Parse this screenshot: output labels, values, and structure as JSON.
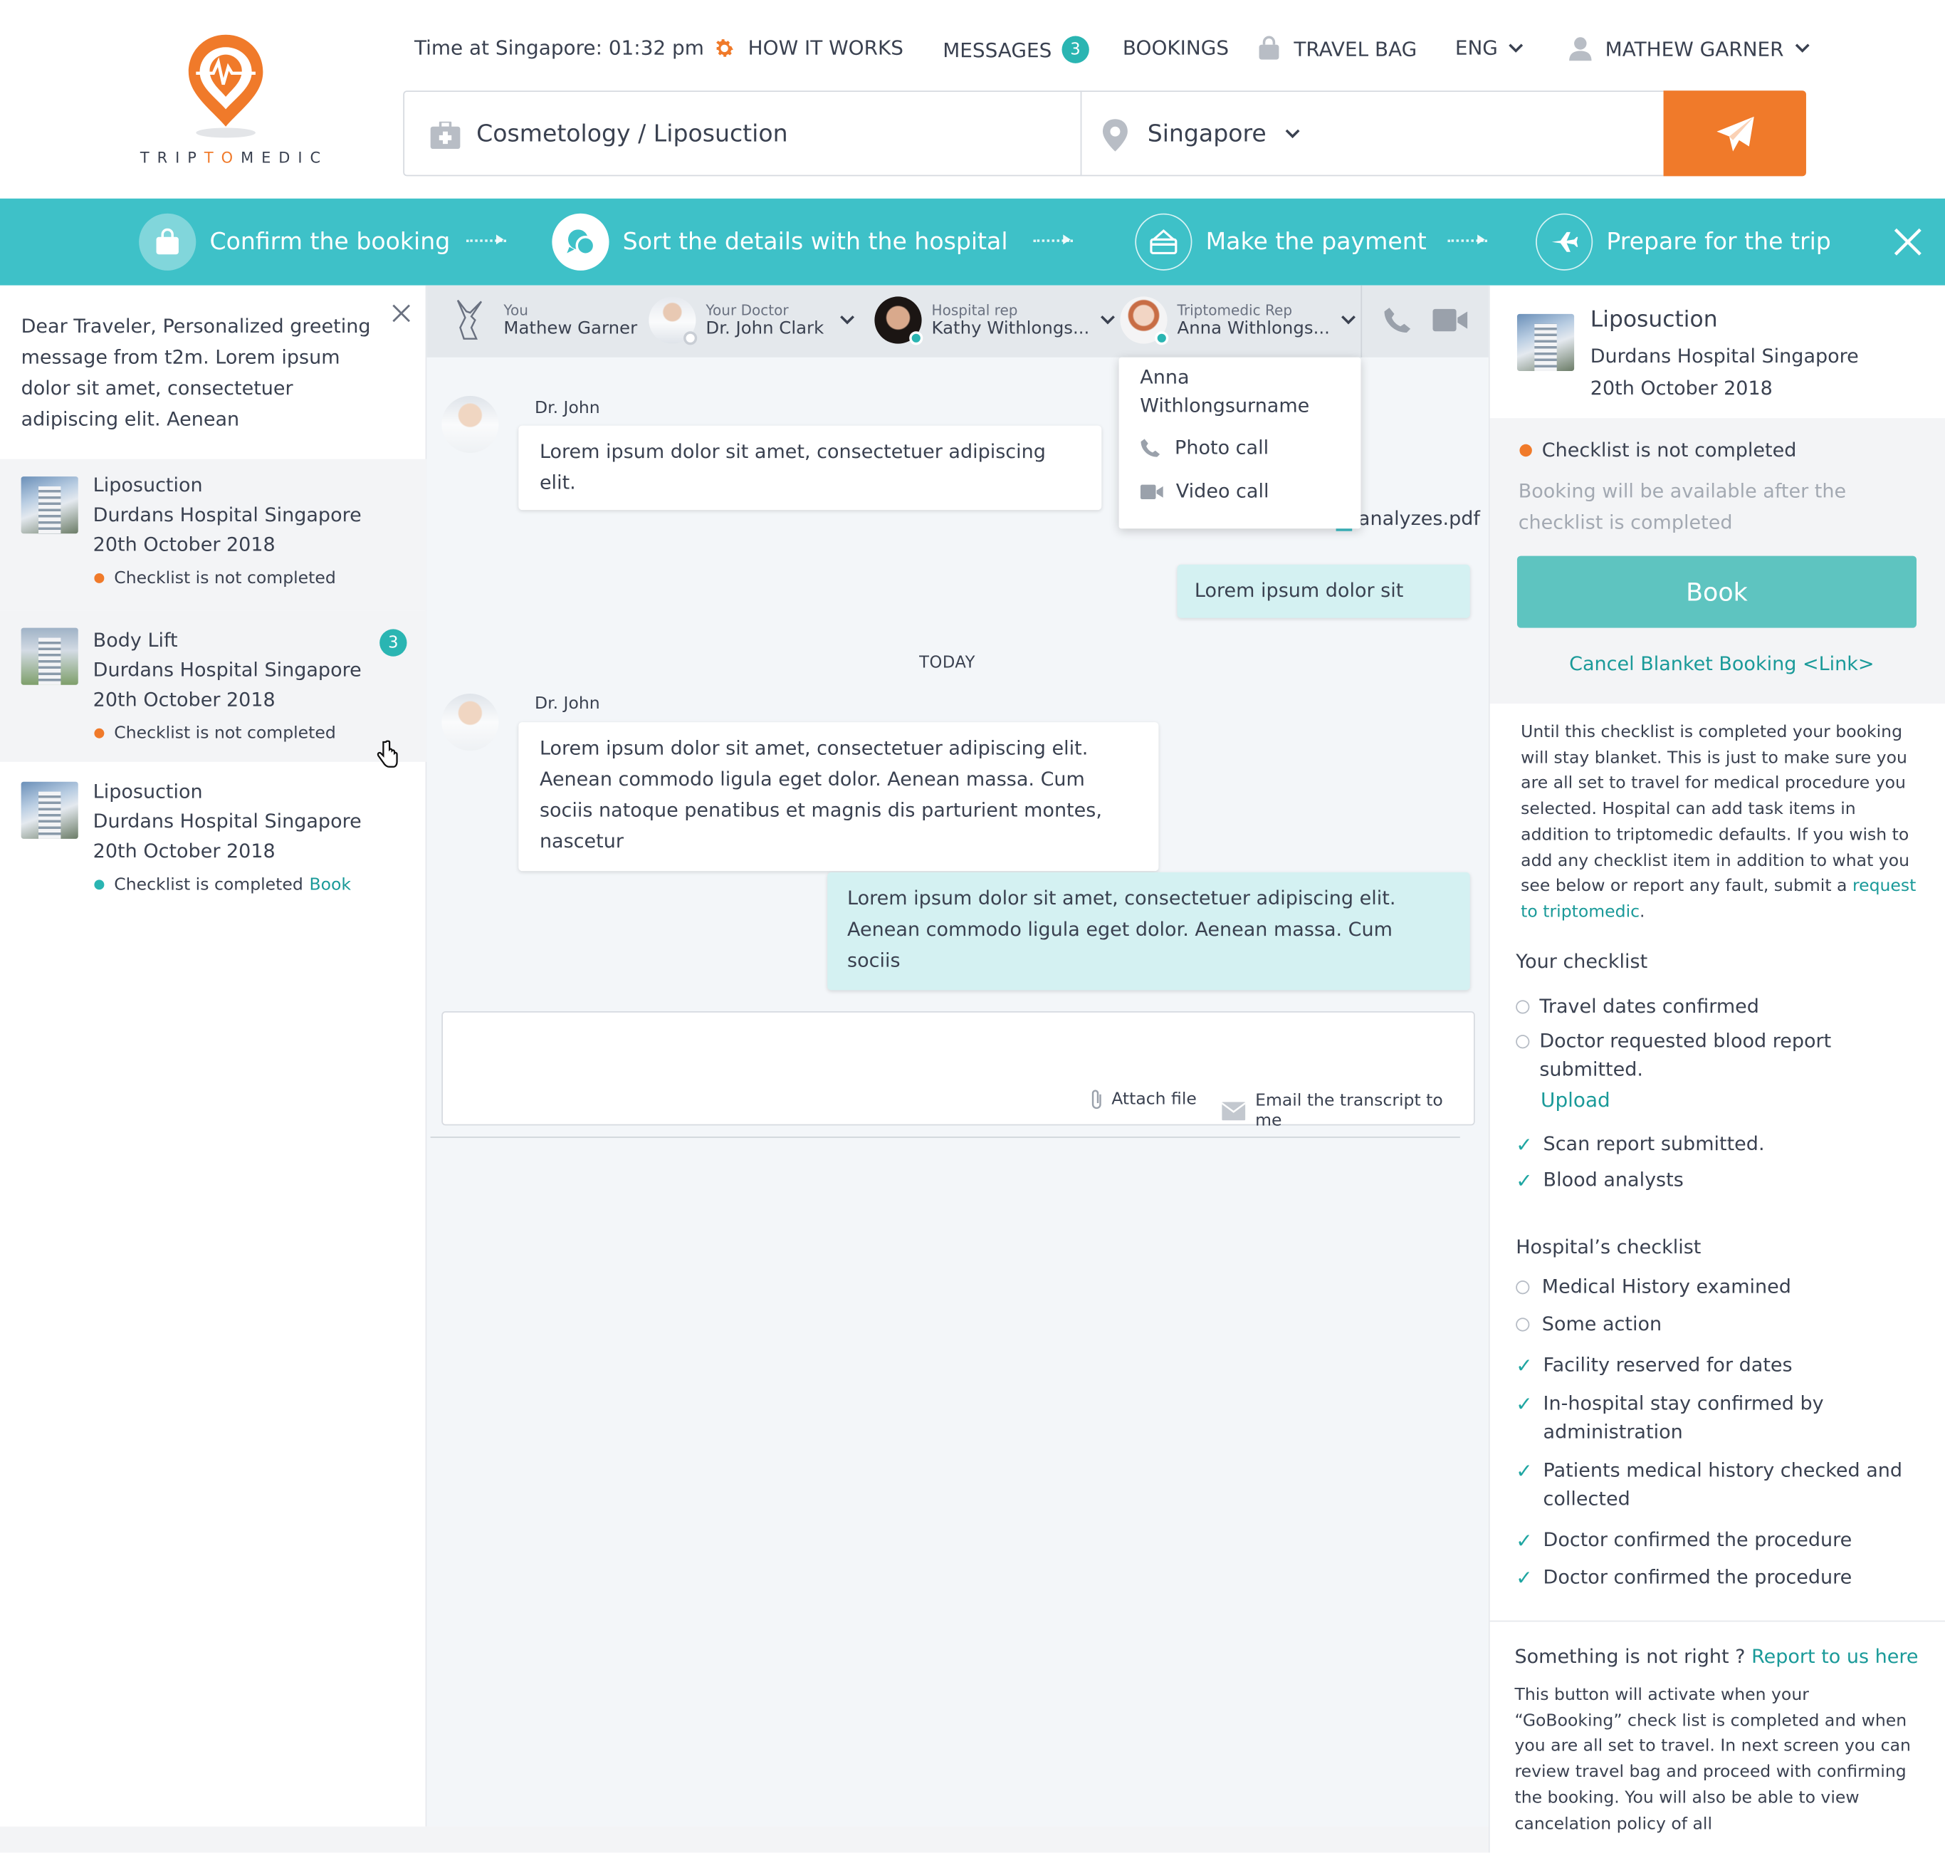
{
  "logo": {
    "text_pre": "TRIP",
    "text_mid": "TO",
    "text_post": "MEDIC"
  },
  "header": {
    "time": "Time at Singapore: 01:32 pm",
    "how_it_works": "HOW IT WORKS",
    "messages": "MESSAGES",
    "messages_count": "3",
    "bookings": "BOOKINGS",
    "travel_bag": "TRAVEL BAG",
    "language": "ENG",
    "user": "MATHEW GARNER"
  },
  "search": {
    "procedure": "Cosmetology / Liposuction",
    "location": "Singapore"
  },
  "steps": [
    {
      "label": "Confirm the booking"
    },
    {
      "label": "Sort the details with the hospital"
    },
    {
      "label": "Make the payment"
    },
    {
      "label": "Prepare for the trip"
    }
  ],
  "greeting": "Dear Traveler, Personalized greeting message from t2m. Lorem ipsum dolor sit amet, consectetuer adipiscing elit. Aenean",
  "bookings": [
    {
      "title": "Liposuction",
      "hospital": "Durdans Hospital Singapore",
      "date": "20th October 2018",
      "status": "Checklist is not completed",
      "status_color": "#f07a2a"
    },
    {
      "title": "Body Lift",
      "hospital": "Durdans Hospital Singapore",
      "date": "20th October 2018",
      "status": "Checklist is not completed",
      "status_color": "#f07a2a",
      "badge": "3"
    },
    {
      "title": "Liposuction",
      "hospital": "Durdans Hospital Singapore",
      "date": "20th October 2018",
      "status": "Checklist is completed",
      "status_color": "#2ab5b2",
      "action": "Book"
    }
  ],
  "participants": [
    {
      "role": "You",
      "name": "Mathew Garner"
    },
    {
      "role": "Your Doctor",
      "name": "Dr. John Clark"
    },
    {
      "role": "Hospital rep",
      "name": "Kathy Withlongs..."
    },
    {
      "role": "Triptomedic Rep",
      "name": "Anna Withlongs..."
    }
  ],
  "dropdown": {
    "name": "Anna Withlongsurname",
    "photo_call": "Photo call",
    "video_call": "Video call"
  },
  "chat": {
    "m1_name": "Dr. John",
    "m1_text": "Lorem ipsum dolor sit amet, consectetuer adipiscing elit.",
    "attachment": "analyzes.pdf",
    "m2_text": "Lorem ipsum dolor sit",
    "divider": "TODAY",
    "m3_name": "Dr. John",
    "m3_text": "Lorem ipsum dolor sit amet, consectetuer adipiscing elit. Aenean commodo ligula eget dolor. Aenean massa. Cum sociis natoque penatibus et magnis dis parturient montes, nascetur",
    "m4_text": "Lorem ipsum dolor sit amet, consectetuer adipiscing elit. Aenean commodo ligula eget dolor. Aenean massa. Cum sociis",
    "attach_file": "Attach file",
    "email_transcript": "Email the transcript to me"
  },
  "summary": {
    "title": "Liposuction",
    "hospital": "Durdans Hospital Singapore",
    "date": "20th October 2018",
    "status": "Checklist is not completed",
    "note": "Booking will be available after the checklist is completed",
    "book": "Book",
    "cancel": "Cancel Blanket Booking <Link>"
  },
  "info": {
    "text": "Until this checklist is completed your booking will stay blanket. This is just to make sure you are all set to travel for medical procedure you selected. Hospital can add task items in addition to triptomedic defaults. If you wish to add any checklist item in addition to what you see below or report any fault, submit a ",
    "link": "request to triptomedic",
    "end": "."
  },
  "your_checklist": {
    "title": "Your checklist",
    "items": [
      {
        "text": "Travel dates confirmed",
        "done": false
      },
      {
        "text": "Doctor requested blood report submitted.",
        "done": false,
        "action": "Upload"
      },
      {
        "text": "Scan report submitted.",
        "done": true
      },
      {
        "text": "Blood analysts",
        "done": true
      }
    ]
  },
  "hospital_checklist": {
    "title": "Hospital’s checklist",
    "items": [
      {
        "text": "Medical History examined",
        "done": false
      },
      {
        "text": "Some action",
        "done": false
      },
      {
        "text": "Facility reserved for dates",
        "done": true
      },
      {
        "text": "In-hospital stay confirmed by administration",
        "done": true
      },
      {
        "text": "Patients medical history checked and collected",
        "done": true
      },
      {
        "text": "Doctor confirmed the procedure",
        "done": true
      },
      {
        "text": "Doctor confirmed the procedure",
        "done": true
      }
    ]
  },
  "report": {
    "question": "Something is not right ?",
    "link": "Report to us here",
    "text": "This button will activate when your “GoBooking” check list is completed and when you are all set to travel. In next screen you can review travel bag and proceed with confirming the booking. You will also be able to view cancelation policy of all"
  },
  "colors": {
    "accent": "#3ec1c8",
    "orange": "#f07a2a",
    "teal": "#2ab5b2"
  }
}
